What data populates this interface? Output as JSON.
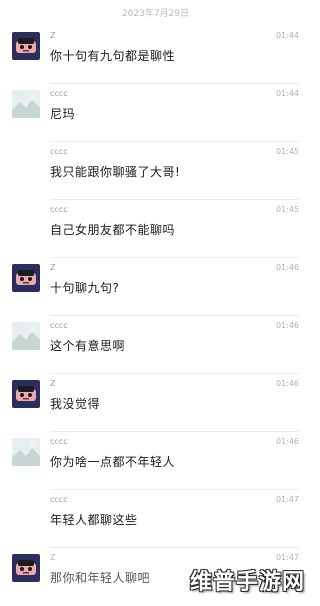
{
  "date_header": "2023年7月29日",
  "messages": [
    {
      "sender": "Z",
      "avatar": "cartoon-avatar",
      "time": "01:44",
      "text": "你十句有九句都是聊性"
    },
    {
      "sender": "cccc",
      "avatar": "landscape-avatar",
      "time": "01:44",
      "text": "尼玛"
    },
    {
      "sender": "cccc",
      "avatar": "",
      "time": "01:45",
      "text": "我只能跟你聊骚了大哥!"
    },
    {
      "sender": "cccc",
      "avatar": "",
      "time": "01:45",
      "text": "自己女朋友都不能聊吗"
    },
    {
      "sender": "Z",
      "avatar": "cartoon-avatar",
      "time": "01:46",
      "text": "十句聊九句?"
    },
    {
      "sender": "cccc",
      "avatar": "landscape-avatar",
      "time": "01:46",
      "text": "这个有意思啊"
    },
    {
      "sender": "Z",
      "avatar": "cartoon-avatar",
      "time": "01:46",
      "text": "我没觉得"
    },
    {
      "sender": "cccc",
      "avatar": "landscape-avatar",
      "time": "01:46",
      "text": "你为啥一点都不年轻人"
    },
    {
      "sender": "cccc",
      "avatar": "",
      "time": "01:47",
      "text": "年轻人都聊这些"
    },
    {
      "sender": "Z",
      "avatar": "cartoon-avatar",
      "time": "01:47",
      "text": "那你和年轻人聊吧"
    }
  ],
  "watermark": "维普手游网"
}
